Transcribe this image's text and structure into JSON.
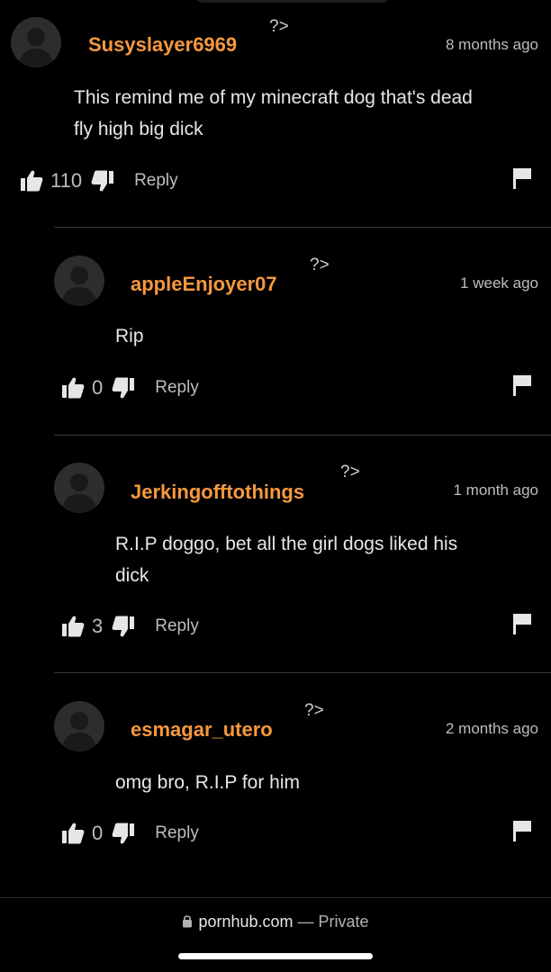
{
  "comments": [
    {
      "username": "Susyslayer6969",
      "marker": "?>",
      "time": "8 months ago",
      "lines": [
        "This remind me of my minecraft dog that's dead",
        "fly high big dick"
      ],
      "likes": "110",
      "reply_label": "Reply"
    },
    {
      "username": "appleEnjoyer07",
      "marker": "?>",
      "time": "1 week ago",
      "lines": [
        "Rip"
      ],
      "likes": "0",
      "reply_label": "Reply"
    },
    {
      "username": "Jerkingofftothings",
      "marker": "?>",
      "time": "1 month ago",
      "lines": [
        "R.I.P doggo, bet all the girl dogs liked his",
        "dick"
      ],
      "likes": "3",
      "reply_label": "Reply"
    },
    {
      "username": "esmagar_utero",
      "marker": "?>",
      "time": "2 months ago",
      "lines": [
        "omg bro, R.I.P for him"
      ],
      "likes": "0",
      "reply_label": "Reply"
    }
  ],
  "footer": {
    "domain": "pornhub.com",
    "mode": "— Private"
  },
  "colors": {
    "username": "#f4983f",
    "background": "#000000",
    "text": "#e6e6e6"
  },
  "icons": [
    "thumbs-up-icon",
    "thumbs-down-icon",
    "flag-icon",
    "lock-icon",
    "avatar-silhouette-icon"
  ]
}
